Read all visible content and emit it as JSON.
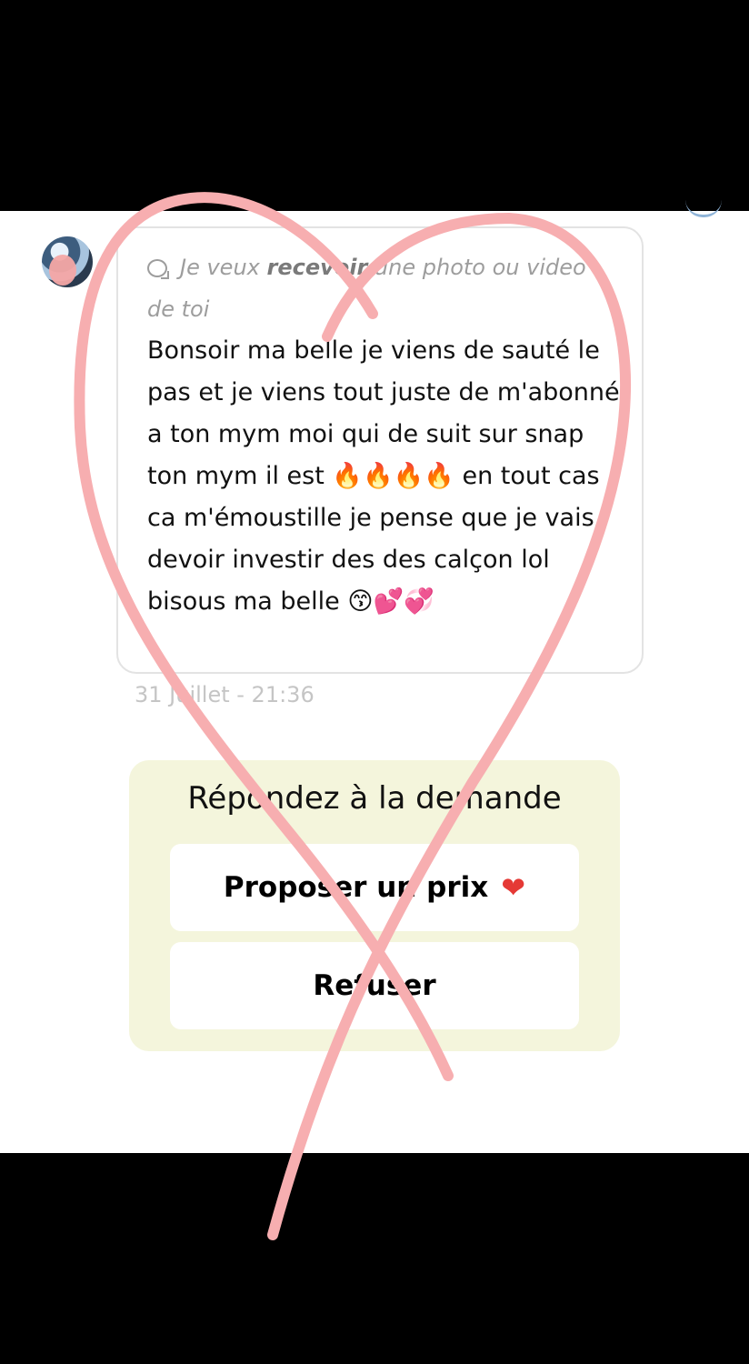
{
  "request": {
    "text_before": "Je veux ",
    "text_bold": "recevoir",
    "text_after": " une photo ou video de toi"
  },
  "message": {
    "body": "Bonsoir ma belle je viens de sauté le pas et je viens tout juste de m'abonné a ton mym moi qui de suit sur snap ton mym il est 🔥🔥🔥🔥 en tout cas ca m'émoustille je pense que je vais devoir investir des des calçon lol bisous ma belle 😙💕💞"
  },
  "timestamp": "31 Juillet - 21:36",
  "response": {
    "title": "Répondez à la demande",
    "propose_label": "Proposer un prix",
    "propose_emoji": "❤",
    "refuse_label": "Refuser"
  },
  "colors": {
    "heart_stroke": "#f7aeb0",
    "response_bg": "#f4f5dc",
    "heart_emoji": "#e53935"
  },
  "icons": {
    "request": "speech-bubble-icon",
    "heart": "heart-icon"
  }
}
